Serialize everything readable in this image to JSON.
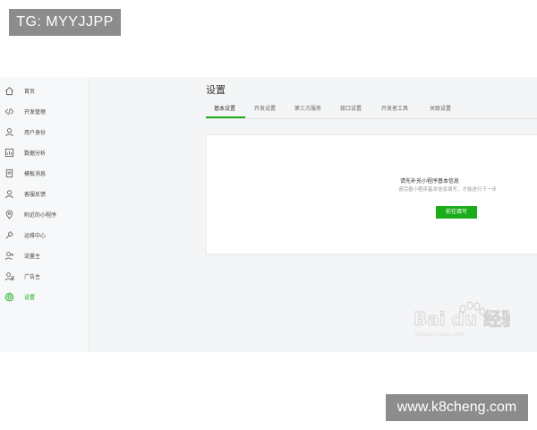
{
  "overlay": {
    "tag_text": "TG: MYYJJPP",
    "site_text": "www.k8cheng.com"
  },
  "sidebar": {
    "items": [
      {
        "label": "首页",
        "icon": "home-icon"
      },
      {
        "label": "开发管理",
        "icon": "code-icon"
      },
      {
        "label": "用户身份",
        "icon": "user-icon"
      },
      {
        "label": "数据分析",
        "icon": "chart-icon"
      },
      {
        "label": "模板消息",
        "icon": "document-icon"
      },
      {
        "label": "客服反馈",
        "icon": "support-icon"
      },
      {
        "label": "附近的小程序",
        "icon": "location-icon"
      },
      {
        "label": "运维中心",
        "icon": "wrench-icon"
      },
      {
        "label": "流量主",
        "icon": "user-plus-icon"
      },
      {
        "label": "广告主",
        "icon": "user-ad-icon"
      },
      {
        "label": "设置",
        "icon": "gear-icon",
        "active": true
      }
    ]
  },
  "main": {
    "title": "设置",
    "tabs": [
      {
        "label": "基本设置",
        "active": true
      },
      {
        "label": "开发设置"
      },
      {
        "label": "第三方服务"
      },
      {
        "label": "接口设置"
      },
      {
        "label": "开发者工具"
      },
      {
        "label": "关联设置"
      }
    ],
    "card": {
      "title": "请先补充小程序基本信息",
      "description": "请完善小程序基本信息填写，才能进行下一步",
      "button_label": "前往填写"
    }
  },
  "colors": {
    "accent": "#1aad19",
    "background": "#f4f5f6",
    "sidebar_bg": "#f7f8f9"
  },
  "brand_mark": {
    "text": "Bai du 经验",
    "sub_text": "jingyan.baidu.com"
  }
}
